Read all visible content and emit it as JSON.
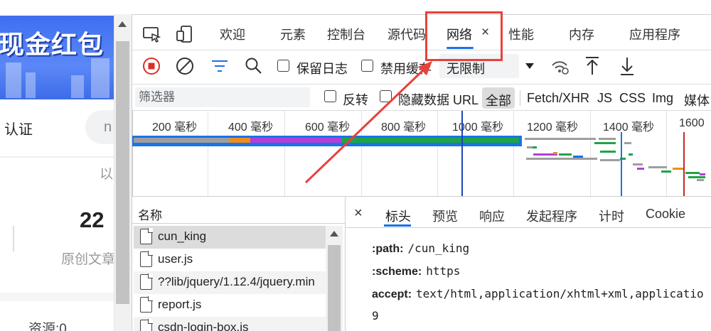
{
  "left_page": {
    "banner_text": "现金红包",
    "cert_label": "认证",
    "pill_text": "n",
    "partial_text": "以",
    "count": "22",
    "count_label": "原创文章",
    "resources_label": "资源:0"
  },
  "tabs": [
    {
      "label": "欢迎"
    },
    {
      "label": "元素"
    },
    {
      "label": "控制台"
    },
    {
      "label": "源代码"
    },
    {
      "label": "网络",
      "active": true,
      "close": "×"
    },
    {
      "label": "性能"
    },
    {
      "label": "内存"
    },
    {
      "label": "应用程序"
    }
  ],
  "toolbar": {
    "preserve_log": "保留日志",
    "disable_cache": "禁用缓存",
    "throttle": "无限制"
  },
  "filter": {
    "placeholder": "筛选器",
    "invert": "反转",
    "hide_data_urls": "隐藏数据 URL",
    "types": [
      "全部",
      "Fetch/XHR",
      "JS",
      "CSS",
      "Img",
      "媒体"
    ]
  },
  "timeline": {
    "ticks": [
      "200 毫秒",
      "400 毫秒",
      "600 毫秒",
      "800 毫秒",
      "1000 毫秒",
      "1200 毫秒",
      "1400 毫秒",
      "1600"
    ]
  },
  "requests": {
    "header": "名称",
    "items": [
      "cun_king",
      "user.js",
      "??lib/jquery/1.12.4/jquery.min",
      "report.js",
      "csdn-login-box.js"
    ]
  },
  "details": {
    "close": "×",
    "tabs": [
      "标头",
      "预览",
      "响应",
      "发起程序",
      "计时",
      "Cookie"
    ],
    "headers": [
      {
        "key": ":path:",
        "value": "/cun_king"
      },
      {
        "key": ":scheme:",
        "value": "https"
      },
      {
        "key": "accept:",
        "value": "text/html,application/xhtml+xml,applicatio"
      },
      {
        "key": "",
        "value": "9"
      }
    ]
  },
  "colors": {
    "accent": "#1a73e8",
    "record": "#d93025",
    "annotation": "#e8413a"
  }
}
